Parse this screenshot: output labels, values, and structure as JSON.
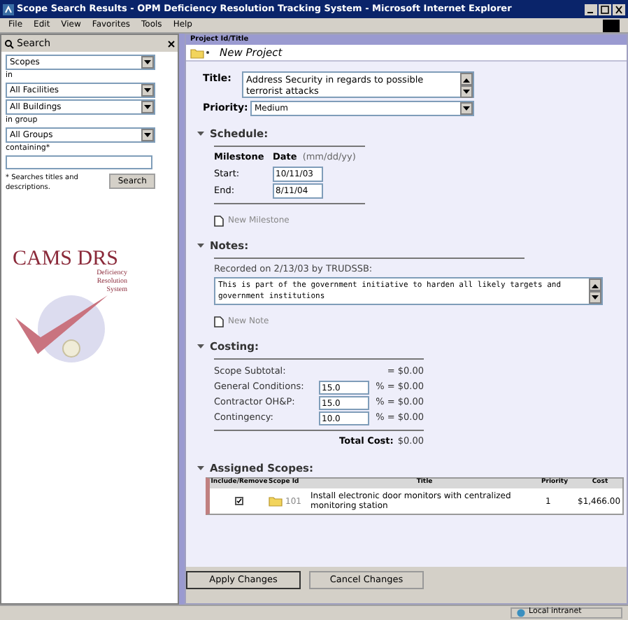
{
  "window": {
    "title": "Scope Search Results - OPM Deficiency Resolution Tracking System - Microsoft Internet Explorer"
  },
  "menu": [
    "File",
    "Edit",
    "View",
    "Favorites",
    "Tools",
    "Help"
  ],
  "sidebar": {
    "title": "Search",
    "scope_select": "Scopes",
    "in_label": "in",
    "facility_select": "All Facilities",
    "building_select": "All Buildings",
    "group_label": "in group",
    "group_select": "All Groups",
    "containing_label": "containing*",
    "footnote": "* Searches titles and descriptions.",
    "search_button": "Search",
    "logo": {
      "name": "CAMS DRS",
      "subtitle": "Deficiency Resolution System"
    }
  },
  "main": {
    "header_label": "Project Id/Title",
    "project_title": "New Project",
    "title_field": {
      "label": "Title:",
      "value": "Address Security in regards to possible terrorist attacks"
    },
    "priority": {
      "label": "Priority:",
      "value": "Medium"
    },
    "schedule": {
      "heading": "Schedule:",
      "expanded": true,
      "col_milestone": "Milestone",
      "col_date": "Date",
      "date_hint": "(mm/dd/yy)",
      "rows": [
        {
          "label": "Start:",
          "value": "10/11/03"
        },
        {
          "label": "End:",
          "value": "8/11/04"
        }
      ],
      "new_link": "New Milestone"
    },
    "notes": {
      "heading": "Notes:",
      "expanded": true,
      "recorded": "Recorded on 2/13/03 by TRUDSSB:",
      "value": "This is part of the government initiative to harden all likely targets and government institutions",
      "new_link": "New Note"
    },
    "costing": {
      "heading": "Costing:",
      "expanded": true,
      "rows": [
        {
          "label": "Scope Subtotal:",
          "amount": "= $0.00"
        },
        {
          "label": "General Conditions:",
          "value": "15.0",
          "amount": "% = $0.00"
        },
        {
          "label": "Contractor OH&P:",
          "value": "15.0",
          "amount": "% = $0.00"
        },
        {
          "label": "Contingency:",
          "value": "10.0",
          "amount": "% = $0.00"
        }
      ],
      "total_label": "Total Cost:",
      "total_value": "$0.00"
    },
    "scopes": {
      "heading": "Assigned Scopes:",
      "expanded": true,
      "columns": [
        "Include/Remove",
        "Scope Id",
        "Title",
        "Priority",
        "Cost"
      ],
      "rows": [
        {
          "included": true,
          "id": "101",
          "title": "Install electronic door monitors with centralized monitoring station",
          "priority": "1",
          "cost": "$1,466.00"
        }
      ]
    }
  },
  "buttons": [
    "Apply Changes",
    "Cancel Changes"
  ],
  "status_bar": {
    "zone": "Local intranet"
  }
}
